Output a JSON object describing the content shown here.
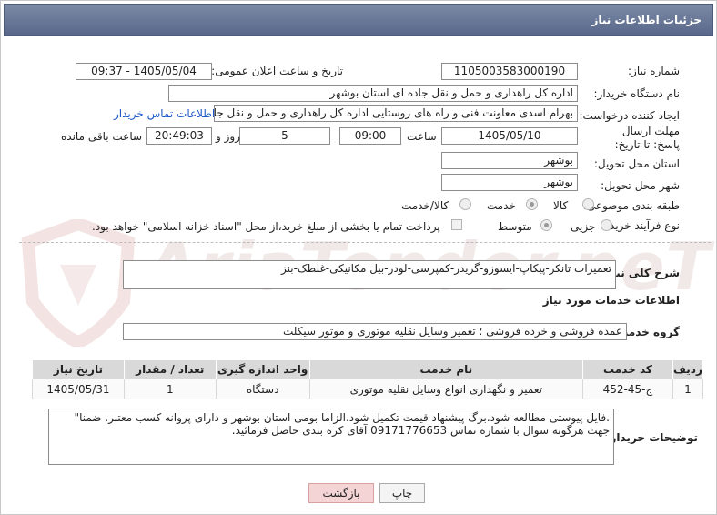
{
  "header": {
    "title": "جزئیات اطلاعات نیاز"
  },
  "labels": {
    "need_number": "شماره نیاز:",
    "announce_datetime": "تاریخ و ساعت اعلان عمومی:",
    "buyer_org": "نام دستگاه خریدار:",
    "requester": "ایجاد کننده درخواست:",
    "deadline": "مهلت ارسال پاسخ: تا تاریخ:",
    "time": "ساعت",
    "days": "روز و",
    "remaining": "ساعت باقی مانده",
    "province": "استان محل تحویل:",
    "city": "شهر محل تحویل:",
    "category": "طبقه بندی موضوعی:",
    "process_type": "نوع فرآیند خرید :",
    "general_desc": "شرح کلی نیاز:",
    "services_info": "اطلاعات خدمات مورد نیاز",
    "service_group": "گروه خدمت:",
    "buyer_notes": "توضیحات خریدار:"
  },
  "values": {
    "need_number": "1105003583000190",
    "announce_datetime": "1405/05/04 - 09:37",
    "buyer_org": "اداره کل راهداری و حمل و نقل جاده ای استان بوشهر",
    "requester": "بهرام اسدی معاونت فنی و راه های روستایی اداره کل راهداری و حمل و نقل جاد",
    "contact_link": "اطلاعات تماس خریدار",
    "deadline_date": "1405/05/10",
    "deadline_time": "09:00",
    "days": "5",
    "remaining_time": "20:49:03",
    "province": "بوشهر",
    "city": "بوشهر",
    "general_desc": "تعمیرات تانکر-پیکاپ-ایسوزو-گریدر-کمپرسی-لودر-بیل مکانیکی-غلطک-بنز",
    "service_group": "عمده فروشی و خرده فروشی ؛ تعمیر وسایل نقلیه موتوری و موتور سیکلت",
    "buyer_notes": ".فایل پیوستی مطالعه شود.برگ پیشنهاد قیمت تکمیل شود.الزاما بومی استان بوشهر و دارای پروانه کسب معتبر. ضمنا\" جهت هرگونه سوال با شماره تماس 09171776653 آقای کره بندی حاصل فرمائید."
  },
  "category_options": [
    {
      "label": "کالا",
      "selected": false
    },
    {
      "label": "خدمت",
      "selected": true
    },
    {
      "label": "کالا/خدمت",
      "selected": false
    }
  ],
  "process_options": [
    {
      "label": "جزیی",
      "selected": false
    },
    {
      "label": "متوسط",
      "selected": true
    }
  ],
  "payment_note": "پرداخت تمام یا بخشی از مبلغ خرید،از محل \"اسناد خزانه اسلامی\" خواهد بود.",
  "table": {
    "headers": [
      "ردیف",
      "کد خدمت",
      "نام خدمت",
      "واحد اندازه گیری",
      "تعداد / مقدار",
      "تاریخ نیاز"
    ],
    "rows": [
      [
        "1",
        "ج-45-452",
        "تعمیر و نگهداری انواع وسایل نقلیه موتوری",
        "دستگاه",
        "1",
        "1405/05/31"
      ]
    ]
  },
  "buttons": {
    "print": "چاپ",
    "back": "بازگشت"
  },
  "watermark": "AriaTender.neT"
}
